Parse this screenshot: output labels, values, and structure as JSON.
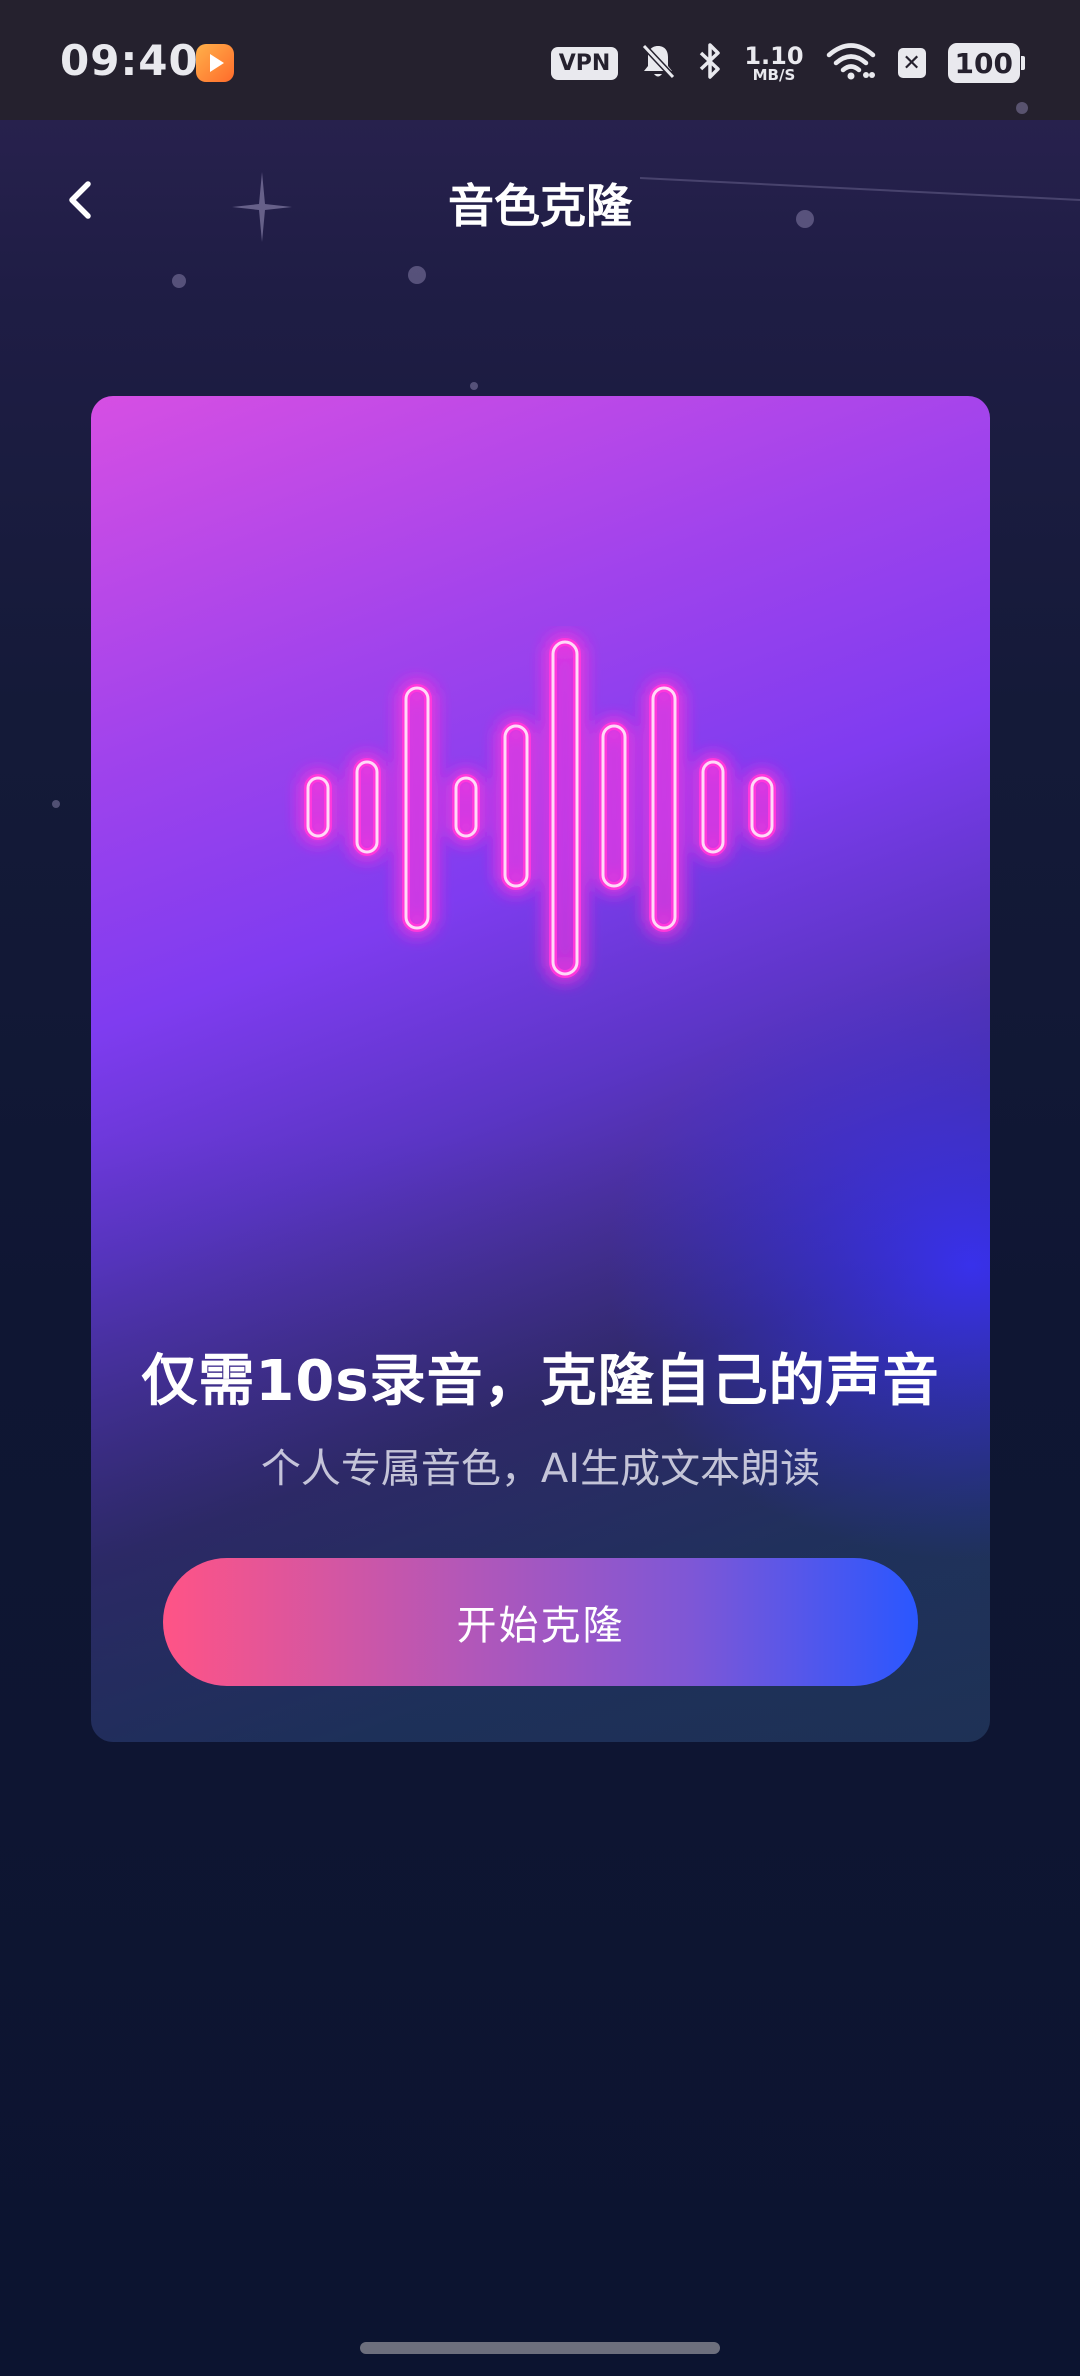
{
  "status_bar": {
    "time": "09:40",
    "app_icon": "video-app-icon",
    "vpn": "VPN",
    "speed_value": "1.10",
    "speed_unit": "MB/S",
    "x_badge": "✕",
    "battery": "100"
  },
  "header": {
    "back_icon": "chevron-left-icon",
    "title": "音色克隆"
  },
  "card": {
    "illustration": "sound-wave-icon",
    "headline": "仅需10s录音，克隆自己的声音",
    "subline": "个人专属音色，AI生成文本朗读",
    "start_button": "开始克隆"
  },
  "colors": {
    "button_start": "#ff5486",
    "button_end": "#2a57ff",
    "neon_pink": "#ff2fd6",
    "background": "#0f1633"
  }
}
